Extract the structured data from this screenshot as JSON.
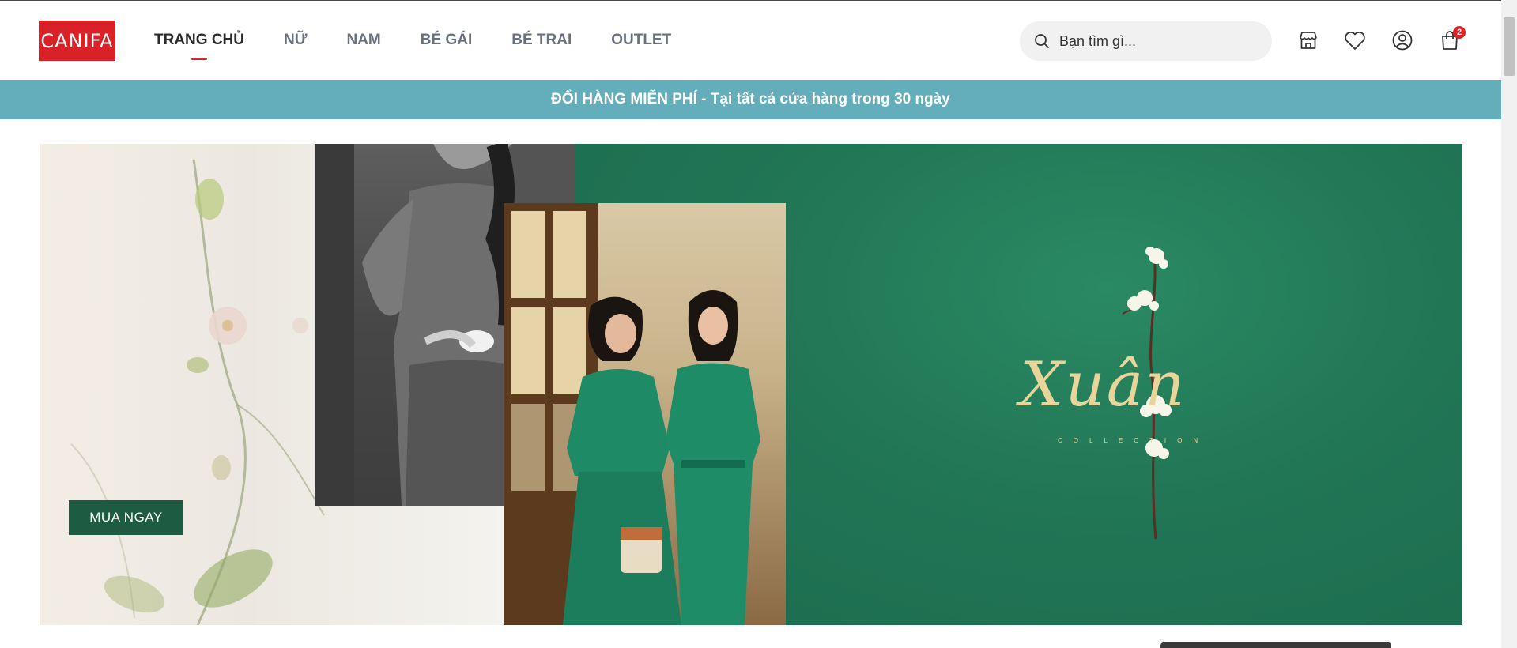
{
  "brand": {
    "logo_text": "CANIFA",
    "color": "#da2128"
  },
  "nav": {
    "items": [
      {
        "label": "TRANG CHỦ",
        "active": true
      },
      {
        "label": "NỮ",
        "active": false
      },
      {
        "label": "NAM",
        "active": false
      },
      {
        "label": "BÉ GÁI",
        "active": false
      },
      {
        "label": "BÉ TRAI",
        "active": false
      },
      {
        "label": "OUTLET",
        "active": false
      }
    ]
  },
  "search": {
    "placeholder": "Bạn tìm gì..."
  },
  "header_icons": [
    "store-icon",
    "heart-icon",
    "user-icon",
    "cart-icon"
  ],
  "cart": {
    "count": "2"
  },
  "promo": {
    "text": "ĐỔI HÀNG MIỄN PHÍ - Tại tất cả cửa hàng trong 30 ngày",
    "color": "#64aebb"
  },
  "hero": {
    "cta_label": "MUA NGAY",
    "title": "Xuân",
    "subtitle": "COLLECTION",
    "accent": "#207a59"
  }
}
